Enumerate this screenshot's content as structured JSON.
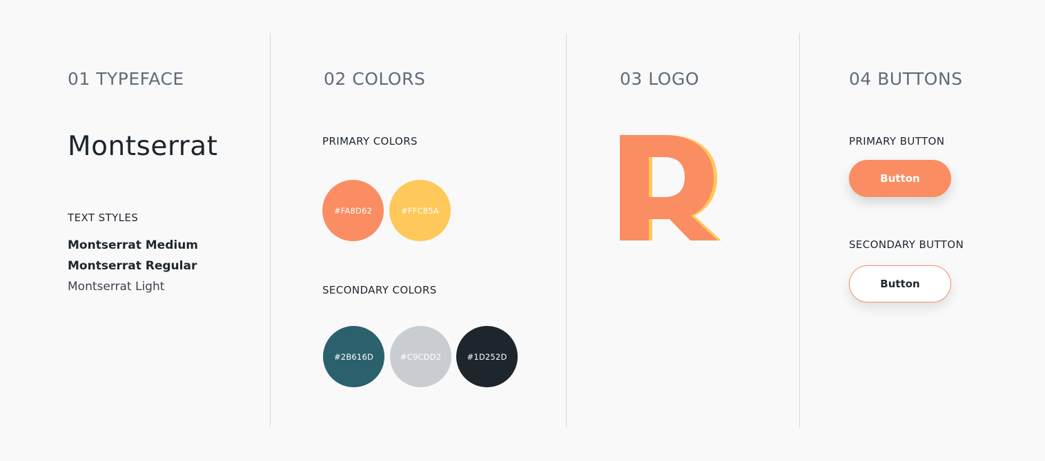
{
  "sections": {
    "typeface": {
      "title": "01 TYPEFACE",
      "font_name": "Montserrat",
      "text_styles_label": "TEXT STYLES",
      "styles": [
        "Montserrat Medium",
        "Montserrat Regular",
        "Montserrat Light"
      ]
    },
    "colors": {
      "title": "02 COLORS",
      "primary_label": "PRIMARY COLORS",
      "primary": [
        "#FA8D62",
        "#FFC85A"
      ],
      "secondary_label": "SECONDARY COLORS",
      "secondary": [
        "#2B616D",
        "#C9CDD2",
        "#1D252D"
      ]
    },
    "logo": {
      "title": "03 LOGO",
      "letter": "R",
      "fill_color": "#FA8D62",
      "shadow_color": "#FFC85A"
    },
    "buttons": {
      "title": "04 BUTTONS",
      "primary_label": "PRIMARY BUTTON",
      "primary_text": "Button",
      "secondary_label": "SECONDARY BUTTON",
      "secondary_text": "Button"
    }
  }
}
